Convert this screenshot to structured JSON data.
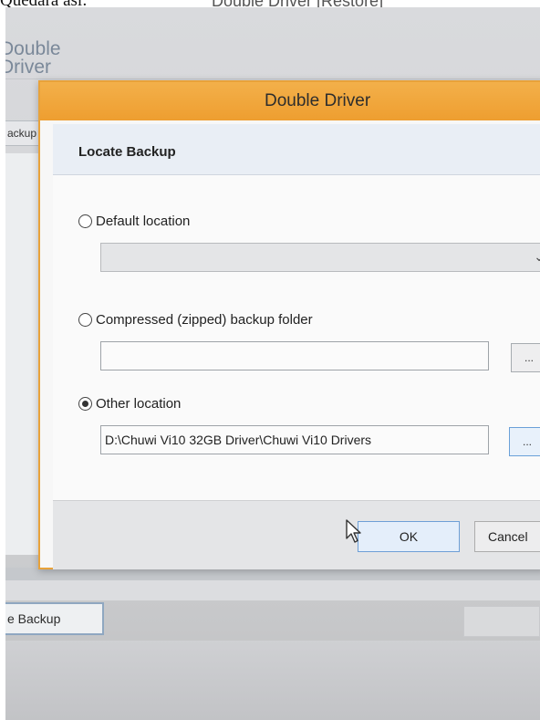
{
  "caption": {
    "left_text": "Quedará así:",
    "window_title": "Double Driver [Restore]"
  },
  "background_window": {
    "app_name_line1": "Double",
    "app_name_line2": "Driver",
    "tab_label": "ackup",
    "backup_button_label": "e Backup"
  },
  "dialog": {
    "title": "Double Driver",
    "header": "Locate Backup",
    "options": [
      {
        "label": "Default location",
        "checked": false
      },
      {
        "label": "Compressed (zipped) backup folder",
        "checked": false
      },
      {
        "label": "Other location",
        "checked": true
      }
    ],
    "default_location_value": "",
    "compressed_path_value": "",
    "other_location_value": "D:\\Chuwi Vi10 32GB Driver\\Chuwi Vi10 Drivers",
    "browse_label": "...",
    "ok_label": "OK",
    "cancel_label": "Cancel"
  },
  "colors": {
    "accent_orange": "#ee9e30",
    "focus_blue": "#6e9fd6",
    "header_bg": "#e9eef5"
  },
  "icons": {
    "dropdown": "chevron-down-icon",
    "cursor": "mouse-pointer-icon"
  }
}
